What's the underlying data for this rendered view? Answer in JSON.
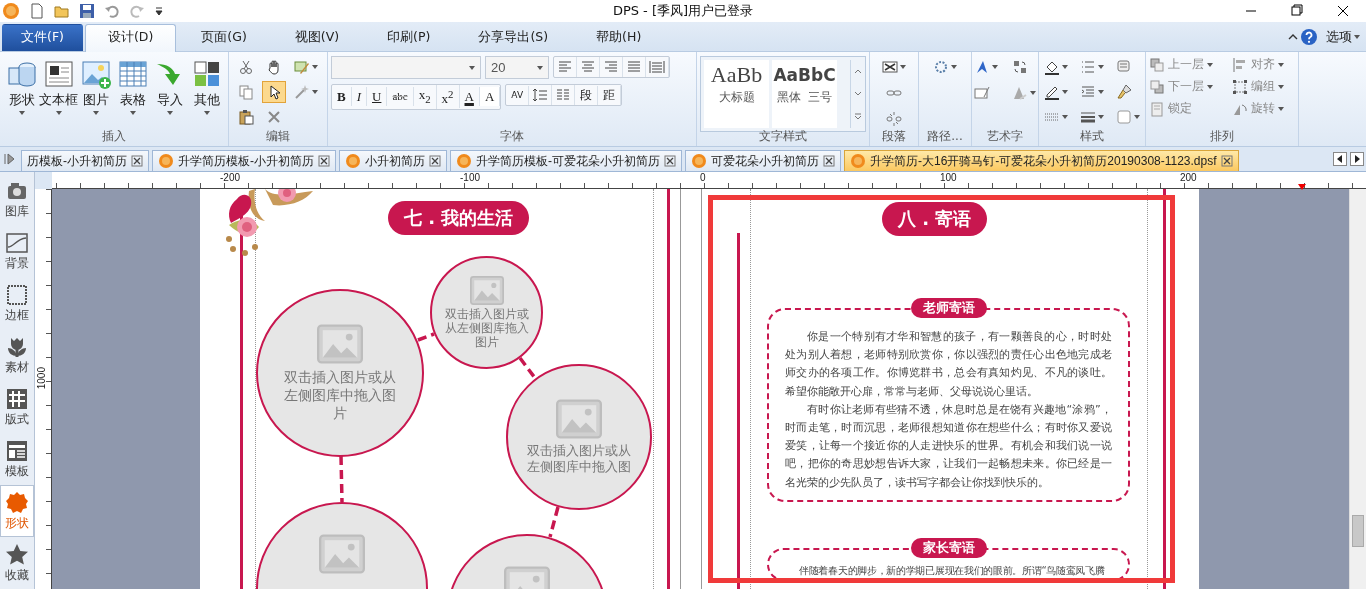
{
  "window": {
    "title": "DPS - [季风]用户已登录"
  },
  "menu_tabs": [
    {
      "label": "文件(F)",
      "kind": "file",
      "selected": false
    },
    {
      "label": "设计(D)",
      "kind": "tab",
      "selected": true
    },
    {
      "label": "页面(G)",
      "kind": "tab",
      "selected": false
    },
    {
      "label": "视图(V)",
      "kind": "tab",
      "selected": false
    },
    {
      "label": "印刷(P)",
      "kind": "tab",
      "selected": false
    },
    {
      "label": "分享导出(S)",
      "kind": "tab",
      "selected": false
    },
    {
      "label": "帮助(H)",
      "kind": "tab",
      "selected": false
    }
  ],
  "options_label": "选项",
  "insert_group": {
    "label": "插入",
    "buttons": [
      "形状",
      "文本框",
      "图片",
      "表格",
      "导入",
      "其他"
    ]
  },
  "edit_group": {
    "label": "编辑",
    "pointer_selected": true
  },
  "font_group": {
    "label": "字体",
    "font_size": "20",
    "format_buttons": [
      {
        "label": "B",
        "kind": "bold"
      },
      {
        "label": "I",
        "kind": "italic"
      },
      {
        "label": "U",
        "kind": "underline"
      },
      {
        "label": "abc",
        "kind": "strike"
      },
      {
        "label": "x$_{2}$",
        "kind": "plain"
      },
      {
        "label": "x$^{2}$",
        "kind": "plain"
      },
      {
        "label": "A",
        "kind": "color"
      },
      {
        "label": "A",
        "kind": "highlight"
      }
    ],
    "spacing_label": "AV",
    "paragraph_buttons": [
      "段",
      "距"
    ]
  },
  "text_style_group": {
    "label": "文字样式",
    "styles": [
      {
        "sample": "AaBb",
        "name": "大标题"
      },
      {
        "sample": "AaBbC",
        "name": "黑体  三号"
      }
    ]
  },
  "paragraph_group": {
    "label": "段落"
  },
  "path_group": {
    "label": "路径..."
  },
  "art_text_group": {
    "label": "艺术字"
  },
  "style_group": {
    "label": "样式"
  },
  "arrange_group": {
    "label": "排列",
    "buttons": [
      "上一层",
      "对齐",
      "下一层",
      "编组",
      "锁定",
      "旋转"
    ]
  },
  "doc_tabs": [
    {
      "label": "历模板-小升初简历",
      "selected": false
    },
    {
      "label": "升学简历模板-小升初简历",
      "selected": false
    },
    {
      "label": "小升初简历",
      "selected": false
    },
    {
      "label": "升学简历模板-可爱花朵小升初简历",
      "selected": false
    },
    {
      "label": "可爱花朵小升初简历",
      "selected": false
    },
    {
      "label": "升学简历-大16开骑马钉-可爱花朵小升初简历20190308-1123.dpsf",
      "selected": true
    }
  ],
  "ruler": {
    "marks": [
      "-200",
      "-100",
      "0",
      "100",
      "200"
    ],
    "vertical_mark": "1000"
  },
  "sidebar": [
    {
      "label": "图库",
      "selected": false
    },
    {
      "label": "背景",
      "selected": false
    },
    {
      "label": "边框",
      "selected": false
    },
    {
      "label": "素材",
      "selected": false
    },
    {
      "label": "版式",
      "selected": false
    },
    {
      "label": "模板",
      "selected": false
    },
    {
      "label": "形状",
      "selected": true
    },
    {
      "label": "收藏",
      "selected": false
    }
  ],
  "left_page": {
    "section_title": "七 . 我的生活",
    "placeholders": [
      {
        "text": "双击插入图片或从左侧图库中拖入图片"
      },
      {
        "text": "双击插入图片或从左侧图库拖入图片"
      },
      {
        "text": "双击插入图片或从左侧图库中拖入图"
      }
    ]
  },
  "right_page": {
    "section_title": "八 . 寄语",
    "selected": true,
    "teacher": {
      "title": "老师寄语",
      "paragraphs": [
        "你是一个特别有才华和智慧的孩子，有一颗善良的心，时时处处为别人着想，老师特别欣赏你，你以强烈的责任心出色地完成老师交办的各项工作。你博览群书，总会有真知灼见、不凡的谈吐。希望你能敞开心扉，常常与老师、父母说说心里话。",
        "有时你让老师有些猜不透，休息时总是在饶有兴趣地“涂鸦”，时而走笔，时而沉思，老师很想知道你在想些什么；有时你又爱说爱笑，让每一个接近你的人走进快乐的世界。有机会和我们说一说吧，把你的奇思妙想告诉大家，让我们一起畅想未来。你已经是一名光荣的少先队员了，读书写字都会让你找到快乐的。"
      ]
    },
    "parent": {
      "title": "家长寄语",
      "paragraphs": [
        "伴随着春天的脚步，新的学期已展现在我们的眼前。所谓“鸟随鸾凤飞腾"
      ]
    }
  }
}
